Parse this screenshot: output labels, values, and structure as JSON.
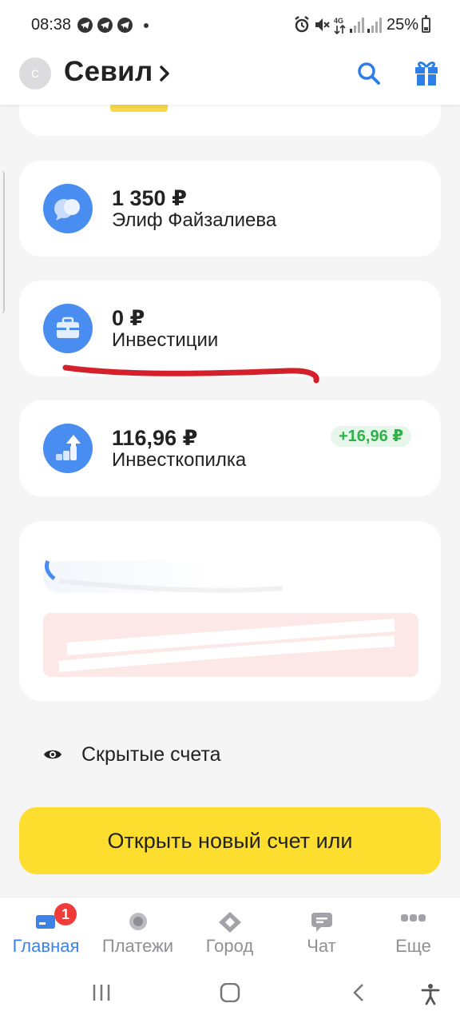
{
  "status_bar": {
    "time": "08:38",
    "battery": "25%",
    "network": "4G",
    "notification_icons": [
      "telegram-icon",
      "telegram-icon",
      "telegram-icon"
    ]
  },
  "header": {
    "avatar_initial": "С",
    "user_name": "Севил",
    "search_icon": "search-icon",
    "gift_icon": "gift-icon",
    "accent_color": "#2d7ee6"
  },
  "accounts": [
    {
      "amount": "1 350 ₽",
      "name": "Элиф Файзалиева",
      "icon": "chat-bubbles-icon",
      "badge": ""
    },
    {
      "amount": "0 ₽",
      "name": "Инвестиции",
      "icon": "briefcase-icon",
      "badge": ""
    },
    {
      "amount": "116,96 ₽",
      "name": "Инвесткопилка",
      "icon": "growth-chart-icon",
      "badge": "+16,96 ₽"
    }
  ],
  "hidden_accounts": {
    "label": "Скрытые счета",
    "icon": "eye-icon"
  },
  "open_account_button": {
    "label": "Открыть новый счет или",
    "color": "#fddd2d"
  },
  "bottom_nav": {
    "active": "Главная",
    "items": [
      {
        "label": "Главная",
        "icon": "card-icon",
        "badge": "1"
      },
      {
        "label": "Платежи",
        "icon": "circle-icon"
      },
      {
        "label": "Город",
        "icon": "city-diamond-icon"
      },
      {
        "label": "Чат",
        "icon": "chat-icon"
      },
      {
        "label": "Еще",
        "icon": "more-dots-icon"
      }
    ]
  },
  "colors": {
    "badge_green": "#2fb24a",
    "badge_red": "#f03b3b",
    "account_icon_blue": "#4a8df0",
    "annotation_red": "#d4202b"
  }
}
